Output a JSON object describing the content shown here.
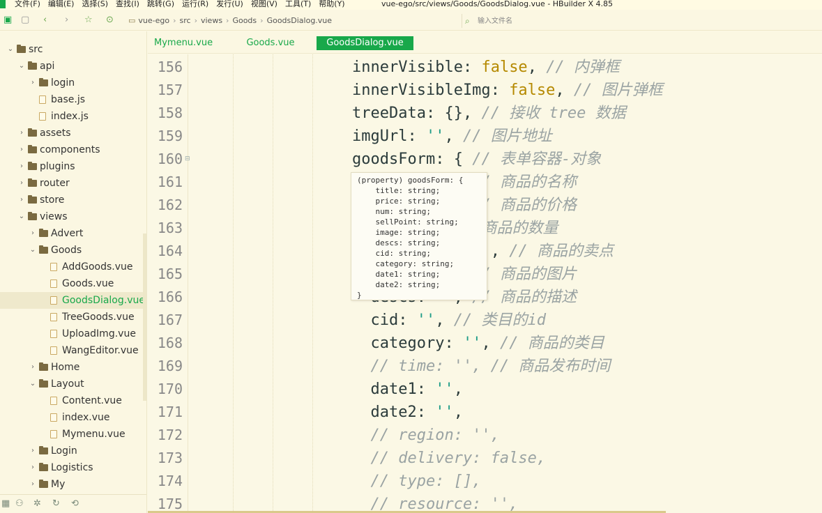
{
  "menubar": {
    "items": [
      "文件(F)",
      "编辑(E)",
      "选择(S)",
      "查找(I)",
      "跳转(G)",
      "运行(R)",
      "发行(U)",
      "视图(V)",
      "工具(T)",
      "帮助(Y)"
    ],
    "window_title": "vue-ego/src/views/Goods/GoodsDialog.vue - HBuilder X 4.85"
  },
  "toolbar": {
    "icons": [
      "save-icon",
      "back-icon",
      "forward-icon",
      "star-icon",
      "run-icon"
    ],
    "breadcrumb": [
      "vue-ego",
      "src",
      "views",
      "Goods",
      "GoodsDialog.vue"
    ],
    "file_search_placeholder": "输入文件名"
  },
  "sidebar": {
    "items": [
      {
        "label": "src",
        "type": "folder",
        "expanded": true,
        "depth": 0
      },
      {
        "label": "api",
        "type": "folder",
        "expanded": true,
        "depth": 1
      },
      {
        "label": "login",
        "type": "folder",
        "expanded": false,
        "depth": 2
      },
      {
        "label": "base.js",
        "type": "file",
        "depth": 2
      },
      {
        "label": "index.js",
        "type": "file",
        "depth": 2
      },
      {
        "label": "assets",
        "type": "folder",
        "expanded": false,
        "depth": 1
      },
      {
        "label": "components",
        "type": "folder",
        "expanded": false,
        "depth": 1
      },
      {
        "label": "plugins",
        "type": "folder",
        "expanded": false,
        "depth": 1
      },
      {
        "label": "router",
        "type": "folder",
        "expanded": false,
        "depth": 1
      },
      {
        "label": "store",
        "type": "folder",
        "expanded": false,
        "depth": 1
      },
      {
        "label": "views",
        "type": "folder",
        "expanded": true,
        "depth": 1
      },
      {
        "label": "Advert",
        "type": "folder",
        "expanded": false,
        "depth": 2
      },
      {
        "label": "Goods",
        "type": "folder",
        "expanded": true,
        "depth": 2
      },
      {
        "label": "AddGoods.vue",
        "type": "file",
        "depth": 3
      },
      {
        "label": "Goods.vue",
        "type": "file",
        "depth": 3
      },
      {
        "label": "GoodsDialog.vue",
        "type": "file",
        "depth": 3,
        "selected": true
      },
      {
        "label": "TreeGoods.vue",
        "type": "file",
        "depth": 3
      },
      {
        "label": "UploadImg.vue",
        "type": "file",
        "depth": 3
      },
      {
        "label": "WangEditor.vue",
        "type": "file",
        "depth": 3
      },
      {
        "label": "Home",
        "type": "folder",
        "expanded": false,
        "depth": 2
      },
      {
        "label": "Layout",
        "type": "folder",
        "expanded": true,
        "depth": 2
      },
      {
        "label": "Content.vue",
        "type": "file",
        "depth": 3
      },
      {
        "label": "index.vue",
        "type": "file",
        "depth": 3
      },
      {
        "label": "Mymenu.vue",
        "type": "file",
        "depth": 3
      },
      {
        "label": "Login",
        "type": "folder",
        "expanded": false,
        "depth": 2
      },
      {
        "label": "Logistics",
        "type": "folder",
        "expanded": false,
        "depth": 2
      },
      {
        "label": "My",
        "type": "folder",
        "expanded": false,
        "depth": 2
      }
    ],
    "bottom_icons": [
      "grid-icon",
      "binoculars-icon",
      "bug-icon",
      "refresh-icon",
      "sync-icon"
    ]
  },
  "tabs": [
    {
      "label": "Mymenu.vue",
      "active": false
    },
    {
      "label": "Goods.vue",
      "active": false
    },
    {
      "label": "GoodsDialog.vue",
      "active": true
    }
  ],
  "editor": {
    "line_numbers": [
      "156",
      "157",
      "158",
      "159",
      "160",
      "161",
      "162",
      "163",
      "164",
      "165",
      "166",
      "167",
      "168",
      "169",
      "170",
      "171",
      "172",
      "173",
      "174",
      "175"
    ],
    "lines": [
      [
        [
          "key",
          "innerVisible"
        ],
        [
          "punc",
          ": "
        ],
        [
          "bool",
          "false"
        ],
        [
          "punc",
          ", "
        ],
        [
          "com",
          "// 内弹框"
        ]
      ],
      [
        [
          "key",
          "innerVisibleImg"
        ],
        [
          "punc",
          ": "
        ],
        [
          "bool",
          "false"
        ],
        [
          "punc",
          ", "
        ],
        [
          "com",
          "// 图片弹框"
        ]
      ],
      [
        [
          "key",
          "treeData"
        ],
        [
          "punc",
          ": {}, "
        ],
        [
          "com",
          "// 接收 tree 数据"
        ]
      ],
      [
        [
          "key",
          "imgUrl"
        ],
        [
          "punc",
          ": "
        ],
        [
          "str",
          "''"
        ],
        [
          "punc",
          ", "
        ],
        [
          "com",
          "// 图片地址"
        ]
      ],
      [
        [
          "key",
          "goodsForm"
        ],
        [
          "punc",
          ": { "
        ],
        [
          "com",
          "// 表单容器-对象"
        ]
      ],
      [
        [
          "key",
          "  title"
        ],
        [
          "punc",
          ": "
        ],
        [
          "str",
          "''"
        ],
        [
          "punc",
          ", "
        ],
        [
          "com",
          "// 商品的名称"
        ]
      ],
      [
        [
          "key",
          "  price"
        ],
        [
          "punc",
          ": "
        ],
        [
          "str",
          "''"
        ],
        [
          "punc",
          ", "
        ],
        [
          "com",
          "// 商品的价格"
        ]
      ],
      [
        [
          "key",
          "  num"
        ],
        [
          "punc",
          ": "
        ],
        [
          "str",
          "''"
        ],
        [
          "punc",
          ", "
        ],
        [
          "com",
          "// 商品的数量"
        ]
      ],
      [
        [
          "key",
          "  sellPoint"
        ],
        [
          "punc",
          ": "
        ],
        [
          "str",
          "''"
        ],
        [
          "punc",
          ", "
        ],
        [
          "com",
          "// 商品的卖点"
        ]
      ],
      [
        [
          "key",
          "  image"
        ],
        [
          "punc",
          ": "
        ],
        [
          "str",
          "''"
        ],
        [
          "punc",
          ", "
        ],
        [
          "com",
          "// 商品的图片"
        ]
      ],
      [
        [
          "key",
          "  descs"
        ],
        [
          "punc",
          ": "
        ],
        [
          "str",
          "''"
        ],
        [
          "punc",
          ", "
        ],
        [
          "com",
          "// 商品的描述"
        ]
      ],
      [
        [
          "key",
          "  cid"
        ],
        [
          "punc",
          ": "
        ],
        [
          "str",
          "''"
        ],
        [
          "punc",
          ", "
        ],
        [
          "com",
          "// 类目的id"
        ]
      ],
      [
        [
          "key",
          "  category"
        ],
        [
          "punc",
          ": "
        ],
        [
          "str",
          "''"
        ],
        [
          "punc",
          ", "
        ],
        [
          "com",
          "// 商品的类目"
        ]
      ],
      [
        [
          "com",
          "  // time: '', // 商品发布时间"
        ]
      ],
      [
        [
          "key",
          "  date1"
        ],
        [
          "punc",
          ": "
        ],
        [
          "str",
          "''"
        ],
        [
          "punc",
          ","
        ]
      ],
      [
        [
          "key",
          "  date2"
        ],
        [
          "punc",
          ": "
        ],
        [
          "str",
          "''"
        ],
        [
          "punc",
          ","
        ]
      ],
      [
        [
          "com",
          "  // region: '',"
        ]
      ],
      [
        [
          "com",
          "  // delivery: false,"
        ]
      ],
      [
        [
          "com",
          "  // type: [],"
        ]
      ],
      [
        [
          "com",
          "  // resource: '',"
        ]
      ]
    ],
    "tooltip": "(property) goodsForm: {\n    title: string;\n    price: string;\n    num: string;\n    sellPoint: string;\n    image: string;\n    descs: string;\n    cid: string;\n    category: string;\n    date1: string;\n    date2: string;\n}"
  },
  "colors": {
    "accent": "#18a84a",
    "background": "#fbf8e5",
    "keyword_bool": "#b58900",
    "string": "#1e9c87",
    "comment": "#9aa3a3"
  }
}
